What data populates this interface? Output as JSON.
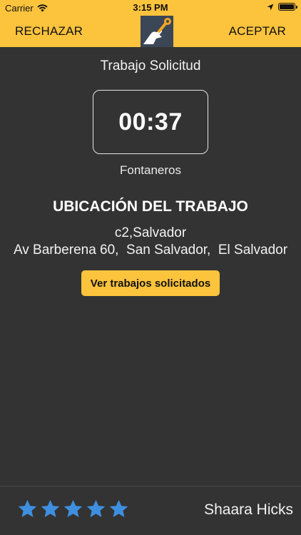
{
  "status_bar": {
    "carrier": "Carrier",
    "time": "3:15 PM",
    "wifi_icon": "wifi-icon",
    "location_icon": "location-arrow-icon",
    "battery_icon": "battery-icon"
  },
  "header": {
    "reject_label": "RECHAZAR",
    "accept_label": "ACEPTAR",
    "logo_icon": "wrench-hand-logo",
    "accent_color": "#FCC33C"
  },
  "main": {
    "title": "Trabajo Solicitud",
    "timer": "00:37",
    "category": "Fontaneros",
    "location_heading": "UBICACIÓN DEL TRABAJO",
    "location_line1": "c2,Salvador",
    "location_line2": "Av Barberena 60,  San Salvador,  El Salvador",
    "view_requests_label": "Ver trabajos solicitados"
  },
  "footer": {
    "rating": 5,
    "rating_max": 5,
    "star_icon": "star-icon",
    "star_color": "#3F8FE0",
    "user_name": "Shaara Hicks"
  }
}
